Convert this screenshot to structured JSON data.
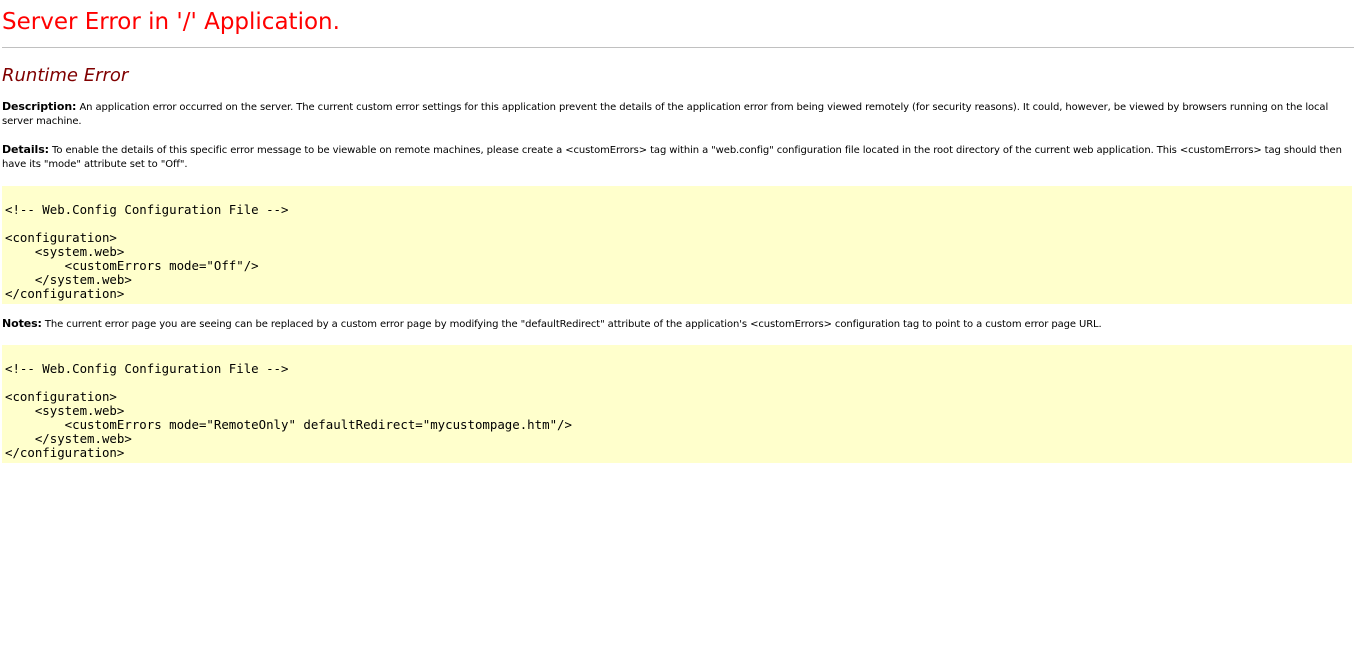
{
  "header": {
    "title": "Server Error in '/' Application."
  },
  "error": {
    "heading": "Runtime Error",
    "description": {
      "label": "Description:",
      "text": " An application error occurred on the server. The current custom error settings for this application prevent the details of the application error from being viewed remotely (for security reasons). It could, however, be viewed by browsers running on the local server machine."
    },
    "details": {
      "label": "Details:",
      "text": " To enable the details of this specific error message to be viewable on remote machines, please create a <customErrors> tag within a \"web.config\" configuration file located in the root directory of the current web application. This <customErrors> tag should then have its \"mode\" attribute set to \"Off\"."
    },
    "code1": {
      "comment": "<!-- Web.Config Configuration File -->",
      "lines": [
        "<configuration>",
        "    <system.web>",
        "        <customErrors mode=\"Off\"/>",
        "    </system.web>",
        "</configuration>"
      ]
    },
    "notes": {
      "label": "Notes:",
      "text": " The current error page you are seeing can be replaced by a custom error page by modifying the \"defaultRedirect\" attribute of the application's <customErrors> configuration tag to point to a custom error page URL."
    },
    "code2": {
      "comment": "<!-- Web.Config Configuration File -->",
      "lines": [
        "<configuration>",
        "    <system.web>",
        "        <customErrors mode=\"RemoteOnly\" defaultRedirect=\"mycustompage.htm\"/>",
        "    </system.web>",
        "</configuration>"
      ]
    }
  },
  "colors": {
    "title": "#ff0000",
    "heading": "#800000",
    "code_background": "#ffffcc",
    "rule": "#c0c0c0"
  }
}
